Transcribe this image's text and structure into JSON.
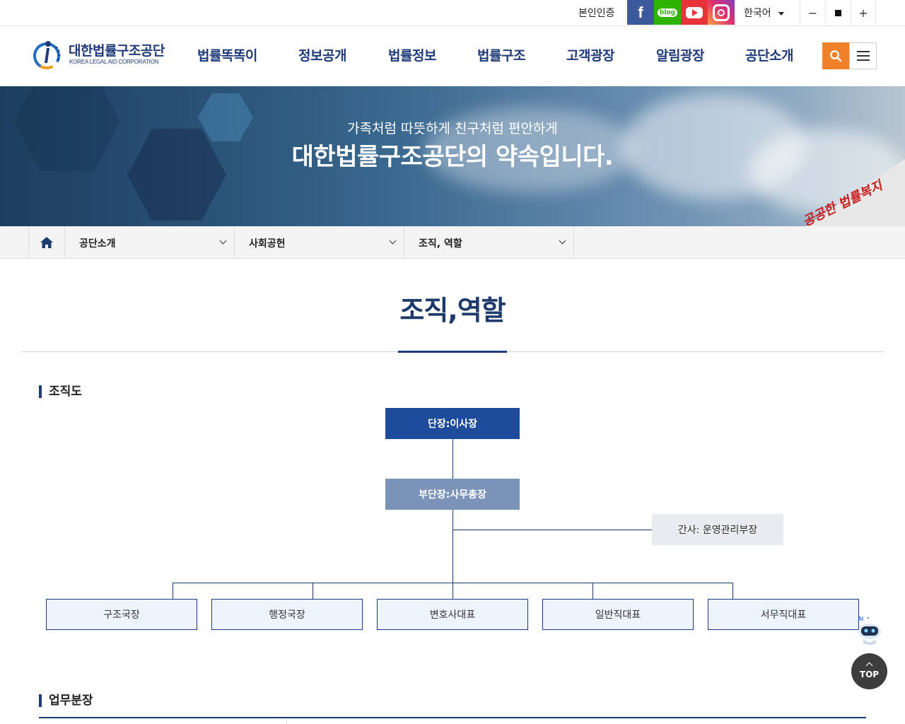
{
  "util": {
    "auth_label": "본인인증",
    "sns": [
      {
        "name": "facebook",
        "icon": "facebook-icon",
        "glyph": "f"
      },
      {
        "name": "blog",
        "icon": "blog-icon",
        "glyph": "blog"
      },
      {
        "name": "youtube",
        "icon": "youtube-icon"
      },
      {
        "name": "instagram",
        "icon": "instagram-icon"
      }
    ],
    "language": "한국어",
    "zoom_out": "−",
    "zoom_in": "+"
  },
  "header": {
    "logo_ko": "대한법률구조공단",
    "logo_en": "KOREA LEGAL AID CORPORATION",
    "nav": [
      "법률똑똑이",
      "정보공개",
      "법률정보",
      "법률구조",
      "고객광장",
      "알림광장",
      "공단소개"
    ]
  },
  "banner": {
    "subtitle": "가족처럼 따뜻하게 친구처럼 편안하게",
    "title": "대한법률구조공단의 약속입니다.",
    "sign_text": "공공한 법률복지"
  },
  "location": {
    "items": [
      "공단소개",
      "사회공헌",
      "조직, 역할"
    ]
  },
  "page": {
    "title": "조직,역할"
  },
  "org_section": {
    "heading": "조직도",
    "head": "단장:이사장",
    "deputy": "부단장:사무총장",
    "secretary": "간사: 운영관리부장",
    "members": [
      "구조국장",
      "행정국장",
      "변호사대표",
      "일반직대표",
      "서무직대표"
    ]
  },
  "duty_section": {
    "heading": "업무분장"
  },
  "floating": {
    "ai_label": "AI",
    "top_label": "TOP"
  },
  "colors": {
    "brand_navy": "#1e3a7a",
    "accent_orange": "#f0812a",
    "head_box": "#1e4b9a",
    "deputy_box": "#7b93b9"
  }
}
